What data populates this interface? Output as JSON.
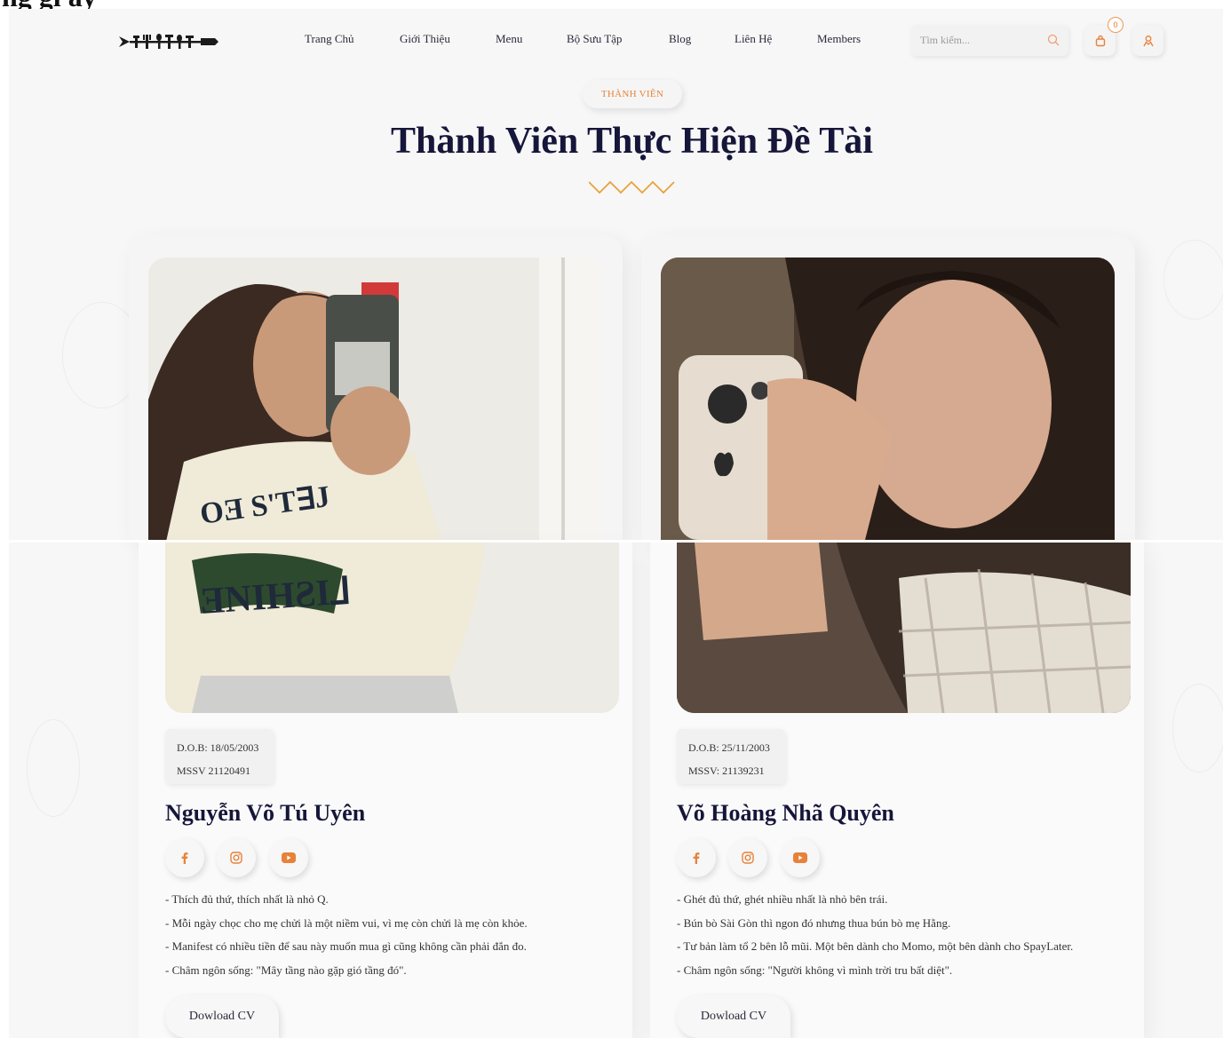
{
  "top_heading": "ng gì ấy",
  "nav": {
    "items": [
      "Trang Chủ",
      "Giới Thiệu",
      "Menu",
      "Bộ Sưu Tập",
      "Blog",
      "Liên Hệ",
      "Members"
    ]
  },
  "search": {
    "placeholder": "Tìm kiếm..."
  },
  "cart": {
    "count": "0"
  },
  "icons": {
    "logo": "cutlery-logo",
    "search": "search-icon",
    "cart": "bag-icon",
    "user": "user-icon"
  },
  "section": {
    "tag": "THÀNH VIÊN",
    "title": "Thành Viên Thực Hiện Đề Tài"
  },
  "colors": {
    "accent": "#e8823a",
    "title": "#16163a",
    "zigzag": "#e8a23a"
  },
  "members": [
    {
      "dob": "D.O.B: 18/05/2003",
      "mssv": "MSSV 21120491",
      "name": "Nguyễn Võ Tú Uyên",
      "bio": [
        "- Thích đủ thứ, thích nhất là nhỏ Q.",
        "- Mỗi ngày chọc cho mẹ chửi là một niềm vui, vì mẹ còn chửi là mẹ còn khỏe.",
        "- Manifest có nhiều tiền để sau này muốn mua gì cũng không cần phải đắn đo.",
        "- Châm ngôn sống: \"Mây tầng nào gặp gió tầng đó\"."
      ],
      "cv_label": "Dowload CV"
    },
    {
      "dob": "D.O.B: 25/11/2003",
      "mssv": "MSSV: 21139231",
      "name": "Võ Hoàng Nhã Quyên",
      "bio": [
        "- Ghét đủ thứ, ghét nhiều nhất là nhỏ bên trái.",
        "- Bún bò Sài Gòn thì ngon đó nhưng thua bún bò mẹ Hằng.",
        "- Tư bản làm tổ 2 bên lỗ mũi. Một bên dành cho Momo, một bên dành cho SpayLater.",
        "- Châm ngôn sống: \"Người không vì mình trời tru bất diệt\"."
      ],
      "cv_label": "Dowload CV"
    }
  ]
}
